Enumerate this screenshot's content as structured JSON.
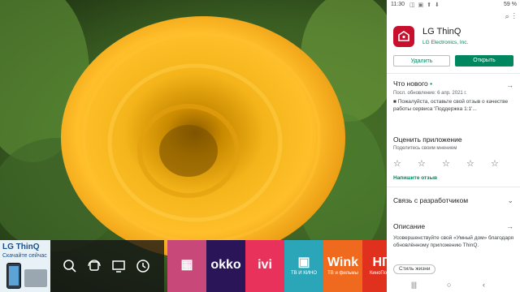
{
  "tv": {
    "promo": {
      "title": "LG ThinQ",
      "subtitle": "Скачайте сейчас"
    },
    "nav_icons": [
      "search-icon",
      "rotate-display-icon",
      "screen-share-icon",
      "recent-history-icon"
    ],
    "apps": [
      {
        "label": "",
        "sub": "",
        "icon": "grid-calendar-icon",
        "color": "#c8487a"
      },
      {
        "label": "okko",
        "sub": "",
        "icon": "okko-logo",
        "color": "#2a1559"
      },
      {
        "label": "ivi",
        "sub": "",
        "icon": "ivi-logo",
        "color": "#e8315b"
      },
      {
        "label": "",
        "sub": "ТВ И КИНО",
        "icon": "tv-film-icon",
        "color": "#2aa6b8"
      },
      {
        "label": "Wink",
        "sub": "ТВ и фильмы",
        "icon": "wink-logo",
        "color": "#ef6a1e"
      },
      {
        "label": "НП",
        "sub": "КиноПоиск",
        "icon": "kinopoisk-logo",
        "color": "#e0301e"
      }
    ]
  },
  "phone": {
    "status": {
      "time": "11:30",
      "battery": "59 %",
      "icons": "◫ ▣ ⬆ ⬇"
    },
    "app": {
      "name": "LG ThinQ",
      "developer": "LG Electronics, Inc.",
      "uninstall_label": "Удалить",
      "open_label": "Открыть"
    },
    "whats_new": {
      "title": "Что нового",
      "date": "Посл. обновление: 6 апр. 2021 г.",
      "body": "■ Пожалуйста, оставьте свой отзыв о качестве работы сервиса 'Поддержка 1:1'..."
    },
    "rate": {
      "title": "Оценить приложение",
      "subtitle": "Поделитесь своим мнением",
      "stars": 5,
      "write_review": "Напишите отзыв"
    },
    "developer_contact": {
      "title": "Связь с разработчиком"
    },
    "description": {
      "title": "Описание",
      "body": "Усовершенствуйте свой «Умный дом» благодаря обновлённому приложению ThinQ.",
      "chip": "Стиль жизни"
    },
    "colors": {
      "accent": "#01875f",
      "logo": "#c8102e"
    }
  }
}
